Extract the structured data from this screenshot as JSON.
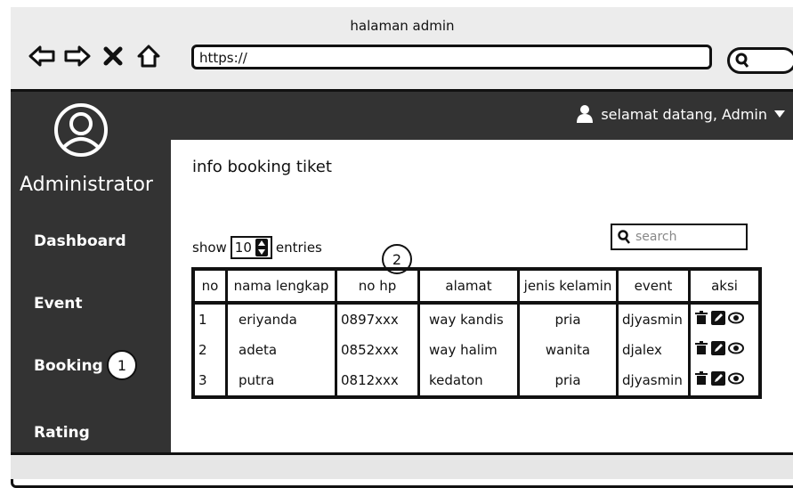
{
  "window": {
    "title": "halaman admin",
    "url": "https://"
  },
  "sidebar": {
    "role": "Administrator",
    "items": [
      {
        "label": "Dashboard"
      },
      {
        "label": "Event"
      },
      {
        "label": "Booking",
        "badge": "1"
      },
      {
        "label": "Rating"
      }
    ]
  },
  "topbar": {
    "greeting": "selamat datang, Admin"
  },
  "main": {
    "title": "info booking tiket",
    "show": {
      "label": "show",
      "value": "10",
      "suffix": "entries"
    },
    "table_badge": "2",
    "search": {
      "placeholder": "search"
    },
    "table": {
      "headers": [
        "no",
        "nama lengkap",
        "no hp",
        "alamat",
        "jenis kelamin",
        "event",
        "aksi"
      ],
      "rows": [
        [
          "1",
          "eriyanda",
          "0897xxx",
          "way kandis",
          "pria",
          "djyasmin"
        ],
        [
          "2",
          "adeta",
          "0852xxx",
          "way halim",
          "wanita",
          "djalex"
        ],
        [
          "3",
          "putra",
          "0812xxx",
          "kedaton",
          "pria",
          "djyasmin"
        ]
      ]
    }
  }
}
